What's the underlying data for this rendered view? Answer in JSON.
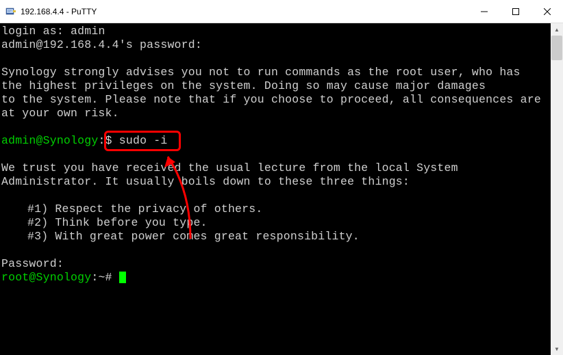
{
  "titlebar": {
    "title": "192.168.4.4 - PuTTY",
    "minimize": "—",
    "maximize": "☐",
    "close": "✕"
  },
  "terminal": {
    "login_prompt": "login as: ",
    "login_user": "admin",
    "pw_prompt_user": "admin@192.168.4.4",
    "pw_prompt_suffix": "'s password:",
    "warning_l1": "Synology strongly advises you not to run commands as the root user, who has",
    "warning_l2": "the highest privileges on the system. Doing so may cause major damages",
    "warning_l3": "to the system. Please note that if you choose to proceed, all consequences are",
    "warning_l4": "at your own risk.",
    "user_prompt_user": "admin@Synology",
    "user_prompt_sep": ":",
    "user_prompt_tilde": "~",
    "user_prompt_dollar": "$ ",
    "user_command": "sudo -i",
    "lecture_l1": "We trust you have received the usual lecture from the local System",
    "lecture_l2": "Administrator. It usually boils down to these three things:",
    "rule1": "#1) Respect the privacy of others.",
    "rule2": "#2) Think before you type.",
    "rule3": "#3) With great power comes great responsibility.",
    "password_label": "Password:",
    "root_prompt_user": "root@Synology",
    "root_prompt_sep": ":",
    "root_prompt_tilde": "~",
    "root_prompt_hash": "# "
  }
}
